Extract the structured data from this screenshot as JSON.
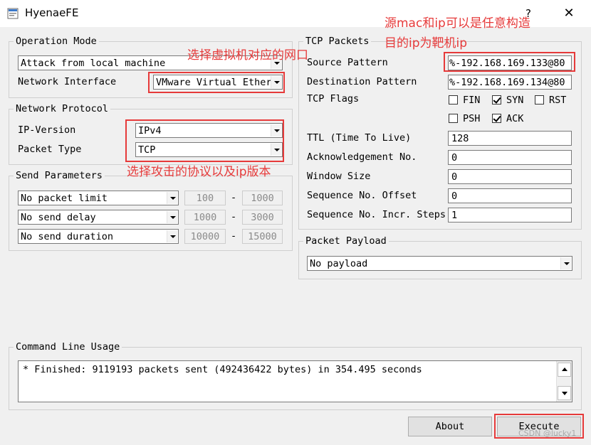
{
  "window": {
    "title": "HyenaeFE",
    "help_glyph": "?",
    "close_glyph": "✕"
  },
  "operation_mode": {
    "legend": "Operation Mode",
    "mode_value": "Attack from local machine",
    "network_interface_label": "Network Interface",
    "network_interface_value": "VMware Virtual Ether"
  },
  "network_protocol": {
    "legend": "Network Protocol",
    "ip_version_label": "IP-Version",
    "ip_version_value": "IPv4",
    "packet_type_label": "Packet Type",
    "packet_type_value": "TCP"
  },
  "send_parameters": {
    "legend": "Send Parameters",
    "rows": [
      {
        "mode": "No packet limit",
        "min": "100",
        "sep": "-",
        "max": "1000"
      },
      {
        "mode": "No send delay",
        "min": "1000",
        "sep": "-",
        "max": "3000"
      },
      {
        "mode": "No send duration",
        "min": "10000",
        "sep": "-",
        "max": "15000"
      }
    ]
  },
  "tcp_packets": {
    "legend": "TCP Packets",
    "source_pattern_label": "Source Pattern",
    "source_pattern_value": "%-192.168.169.133@80",
    "destination_pattern_label": "Destination Pattern",
    "destination_pattern_value": "%-192.168.169.134@80",
    "tcp_flags_label": "TCP Flags",
    "flags": [
      {
        "name": "FIN",
        "checked": false
      },
      {
        "name": "SYN",
        "checked": true
      },
      {
        "name": "RST",
        "checked": false
      },
      {
        "name": "PSH",
        "checked": false
      },
      {
        "name": "ACK",
        "checked": true
      }
    ],
    "ttl_label": "TTL (Time To Live)",
    "ttl_value": "128",
    "ack_no_label": "Acknowledgement No.",
    "ack_no_value": "0",
    "window_size_label": "Window Size",
    "window_size_value": "0",
    "seq_offset_label": "Sequence No. Offset",
    "seq_offset_value": "0",
    "seq_incr_label": "Sequence No. Incr. Steps",
    "seq_incr_value": "1"
  },
  "packet_payload": {
    "legend": "Packet Payload",
    "value": "No payload"
  },
  "command_line": {
    "legend": "Command Line Usage",
    "output": "* Finished: 9119193 packets sent (492436422 bytes) in 354.495 seconds"
  },
  "buttons": {
    "about": "About",
    "execute": "Execute"
  },
  "annotations": {
    "interface_note": "选择虚拟机对应的网口",
    "protocol_note": "选择攻击的协议以及ip版本",
    "source_note_line1": "源mac和ip可以是任意构造",
    "source_note_line2": "目的ip为靶机ip",
    "color": "#e63a3a"
  },
  "watermark": "CSDN @lucky1"
}
